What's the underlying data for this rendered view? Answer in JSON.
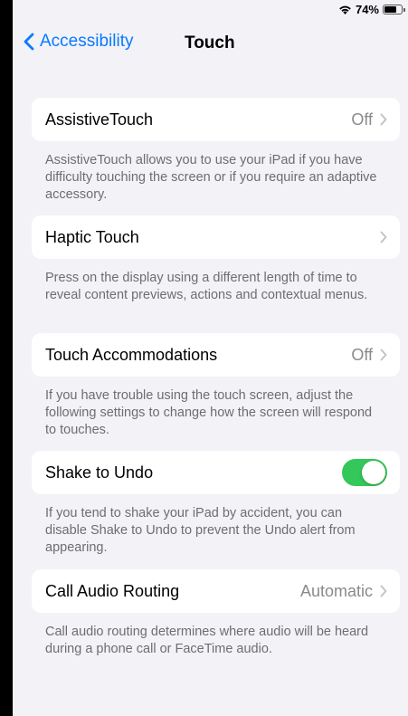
{
  "status": {
    "battery_percent": "74%",
    "battery_level": 0.74
  },
  "nav": {
    "back_label": "Accessibility",
    "title": "Touch"
  },
  "sections": [
    {
      "label": "AssistiveTouch",
      "value": "Off",
      "footer": "AssistiveTouch allows you to use your iPad if you have difficulty touching the screen or if you require an adaptive accessory."
    },
    {
      "label": "Haptic Touch",
      "value": "",
      "footer": "Press on the display using a different length of time to reveal content previews, actions and contextual menus."
    },
    {
      "label": "Touch Accommodations",
      "value": "Off",
      "footer": "If you have trouble using the touch screen, adjust the following settings to change how the screen will respond to touches."
    },
    {
      "label": "Shake to Undo",
      "toggle_on": true,
      "footer": "If you tend to shake your iPad by accident, you can disable Shake to Undo to prevent the Undo alert from appearing."
    },
    {
      "label": "Call Audio Routing",
      "value": "Automatic",
      "footer": "Call audio routing determines where audio will be heard during a phone call or FaceTime audio."
    }
  ],
  "colors": {
    "accent": "#0a7aff",
    "toggle_on": "#34c759",
    "background": "#f2f2f7",
    "secondary_text": "#8a8a8e"
  }
}
